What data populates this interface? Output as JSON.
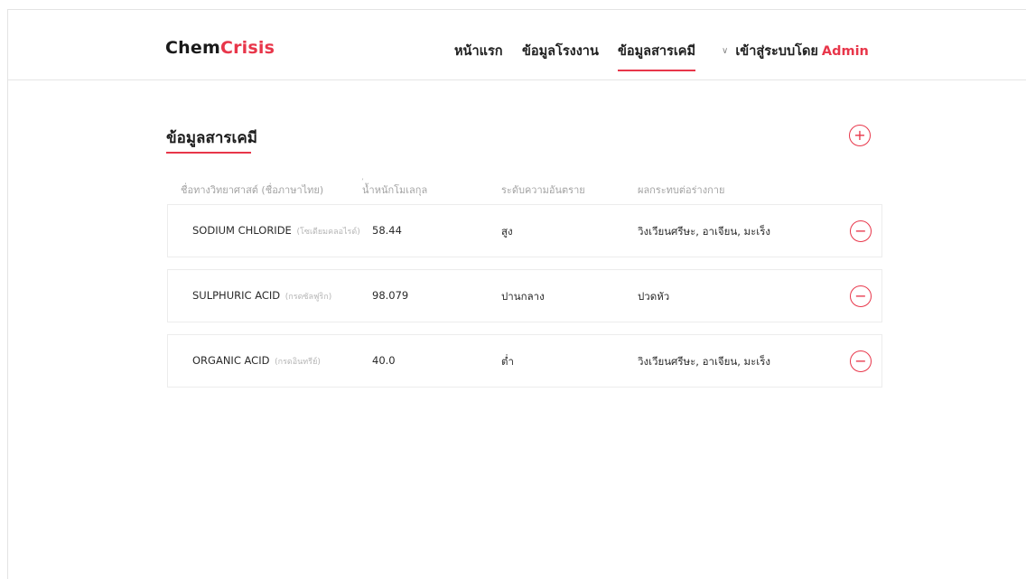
{
  "brand": {
    "part_a": "Chem",
    "part_b": "Crisis"
  },
  "nav": {
    "home": "หน้าแรก",
    "factory": "ข้อมูลโรงงาน",
    "chemical": "ข้อมูลสารเคมี",
    "login_label": "เข้าสู่ระบบโดย",
    "user": "Admin"
  },
  "section": {
    "title": "ข้อมูลสารเคมี"
  },
  "table": {
    "headers": [
      "ชื่อทางวิทยาศาสต์ (ชื่อภาษาไทย)",
      "น้ำหนักโมเลกุล",
      "ระดับความอันตราย",
      "ผลกระทบต่อร่างกาย"
    ],
    "rows": [
      {
        "sci_name": "SODIUM CHLORIDE",
        "thai_name": "(โซเดียมคลอไรด์)",
        "mw": "58.44",
        "hazard": "สูง",
        "effect": "วิงเวียนศรีษะ, อาเจียน, มะเร็ง"
      },
      {
        "sci_name": "SULPHURIC ACID",
        "thai_name": "(กรดซัลฟูริก)",
        "mw": "98.079",
        "hazard": "ปานกลาง",
        "effect": "ปวดหัว"
      },
      {
        "sci_name": "ORGANIC ACID",
        "thai_name": "(กรดอินทรีย์)",
        "mw": "40.0",
        "hazard": "ต่ำ",
        "effect": "วิงเวียนศรีษะ, อาเจียน, มะเร็ง"
      }
    ]
  },
  "icons": {
    "add": "plus-circle-icon",
    "remove": "minus-circle-icon",
    "chevron": "chevron-down-icon"
  },
  "colors": {
    "accent": "#e8364a",
    "text": "#1f1f1f",
    "muted": "#a3a3a3",
    "border": "#ececec"
  }
}
